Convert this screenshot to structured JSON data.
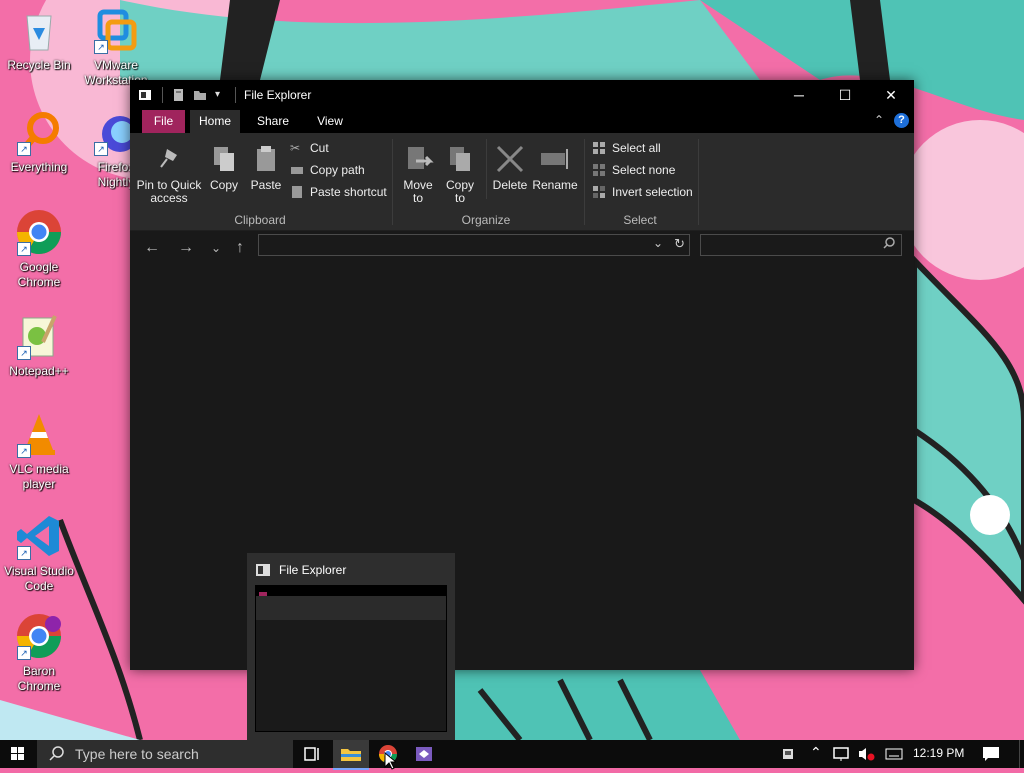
{
  "desktop": {
    "icons": [
      {
        "label": "Recycle Bin",
        "icon": "recycle-bin-icon"
      },
      {
        "label": "VMware Workstation",
        "icon": "vmware-icon"
      },
      {
        "label": "Everything",
        "icon": "everything-icon"
      },
      {
        "label": "Firefox Nightly",
        "icon": "firefox-nightly-icon"
      },
      {
        "label": "Google Chrome",
        "icon": "chrome-icon"
      },
      {
        "label": "Notepad++",
        "icon": "notepadpp-icon"
      },
      {
        "label": "VLC media player",
        "icon": "vlc-icon"
      },
      {
        "label": "Visual Studio Code",
        "icon": "vscode-icon"
      },
      {
        "label": "Baron Chrome",
        "icon": "baron-chrome-icon"
      }
    ]
  },
  "explorer": {
    "title": "File Explorer",
    "tabs": {
      "file": "File",
      "home": "Home",
      "share": "Share",
      "view": "View"
    },
    "clipboard": {
      "pin": "Pin to Quick access",
      "copy": "Copy",
      "paste": "Paste",
      "cut": "Cut",
      "copy_path": "Copy path",
      "paste_shortcut": "Paste shortcut",
      "label": "Clipboard"
    },
    "organize": {
      "move_to": "Move to",
      "copy_to": "Copy to",
      "delete": "Delete",
      "rename": "Rename",
      "label": "Organize"
    },
    "select": {
      "select_all": "Select all",
      "select_none": "Select none",
      "invert": "Invert selection",
      "label": "Select"
    },
    "address": "",
    "search_placeholder": ""
  },
  "preview": {
    "title": "File Explorer"
  },
  "taskbar": {
    "search_placeholder": "Type here to search",
    "clock": "12:19 PM"
  },
  "colors": {
    "accent_file_tab": "#a0245d",
    "explorer_bg": "#191919",
    "ribbon_bg": "#2b2b2b"
  }
}
